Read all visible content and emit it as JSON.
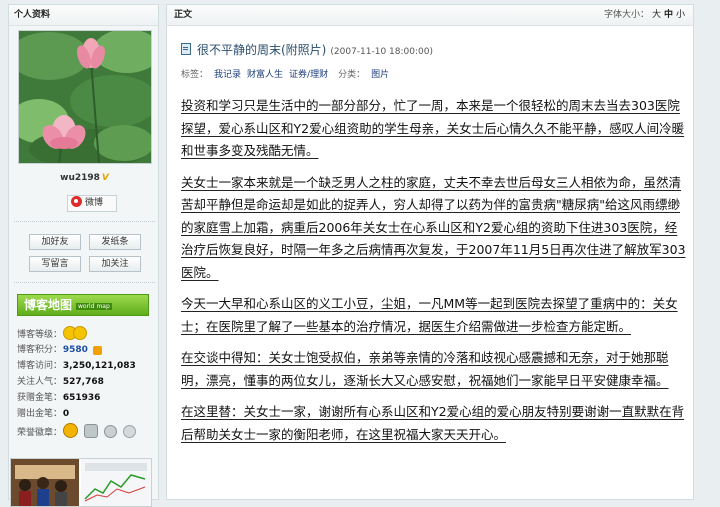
{
  "sidebar": {
    "header": "个人资料",
    "username": "wu2198",
    "verified_mark": "V",
    "weibo_label": "微博",
    "buttons": {
      "add_friend": "加好友",
      "send_note": "发纸条",
      "write_message": "写留言",
      "follow": "加关注"
    },
    "map_banner": {
      "title": "博客地图",
      "subtitle": "world map"
    },
    "stats": [
      {
        "label": "博客等级：",
        "value": ""
      },
      {
        "label": "博客积分：",
        "value": "9580"
      },
      {
        "label": "博客访问：",
        "value": "3,250,121,083"
      },
      {
        "label": "关注人气：",
        "value": "527,768"
      },
      {
        "label": "获赠金笔：",
        "value": "651936"
      },
      {
        "label": "赠出金笔：",
        "value": "0"
      },
      {
        "label": "荣誉徽章：",
        "value": ""
      }
    ]
  },
  "main": {
    "tab_label": "正文",
    "font_size_label": "字体大小：",
    "font_sizes": [
      "大",
      "中",
      "小"
    ],
    "post_title": "很不平静的周末(附照片)",
    "post_date": "(2007-11-10 18:00:00)",
    "tags_label": "标签：",
    "tags": [
      "我记录",
      "财富人生",
      "证券/理财"
    ],
    "category_label": "分类：",
    "category": "图片",
    "paragraphs": [
      "投资和学习只是生活中的一部分部分，忙了一周，本来是一个很轻松的周末去当去303医院探望，爱心系山区和Y2爱心组资助的学生母亲，关女士后心情久久不能平静，感叹人间冷暖和世事多变及残酷无情。",
      "关女士一家本来就是一个缺乏男人之柱的家庭，丈夫不幸去世后母女三人相依为命，虽然清苦却平静但是命运却是如此的捉弄人，穷人却得了以药为伴的富贵病\"糖尿病\"给这风雨缥缈的家庭雪上加霜，病重后2006年关女士在心系山区和Y2爱心组的资助下住进303医院，经治疗后恢复良好，时隔一年多之后病情再次复发，于2007年11月5日再次住进了解放军303医院。",
      "今天一大早和心系山区的义工小豆，尘姐，一凡MM等一起到医院去探望了重病中的：关女士；在医院里了解了一些基本的治疗情况，据医生介绍需做进一步检查方能定断。",
      "在交谈中得知：关女士饱受叔伯，亲弟等亲情的冷落和歧视心感震撼和无奈，对于她那聪明，漂亮，懂事的两位女儿，逐渐长大又心感安慰，祝福她们一家能早日平安健康幸福。",
      "在这里替：关女士一家，谢谢所有心系山区和Y2爱心组的爱心朋友特别要谢谢一直默默在背后帮助关女士一家的衡阳老师，在这里祝福大家天天开心。"
    ]
  },
  "colors": {
    "page_bg": "#e9eef0",
    "map_green": "#5fae1c",
    "title_blue": "#2a4d6b",
    "tag_blue": "#1d3e79"
  }
}
